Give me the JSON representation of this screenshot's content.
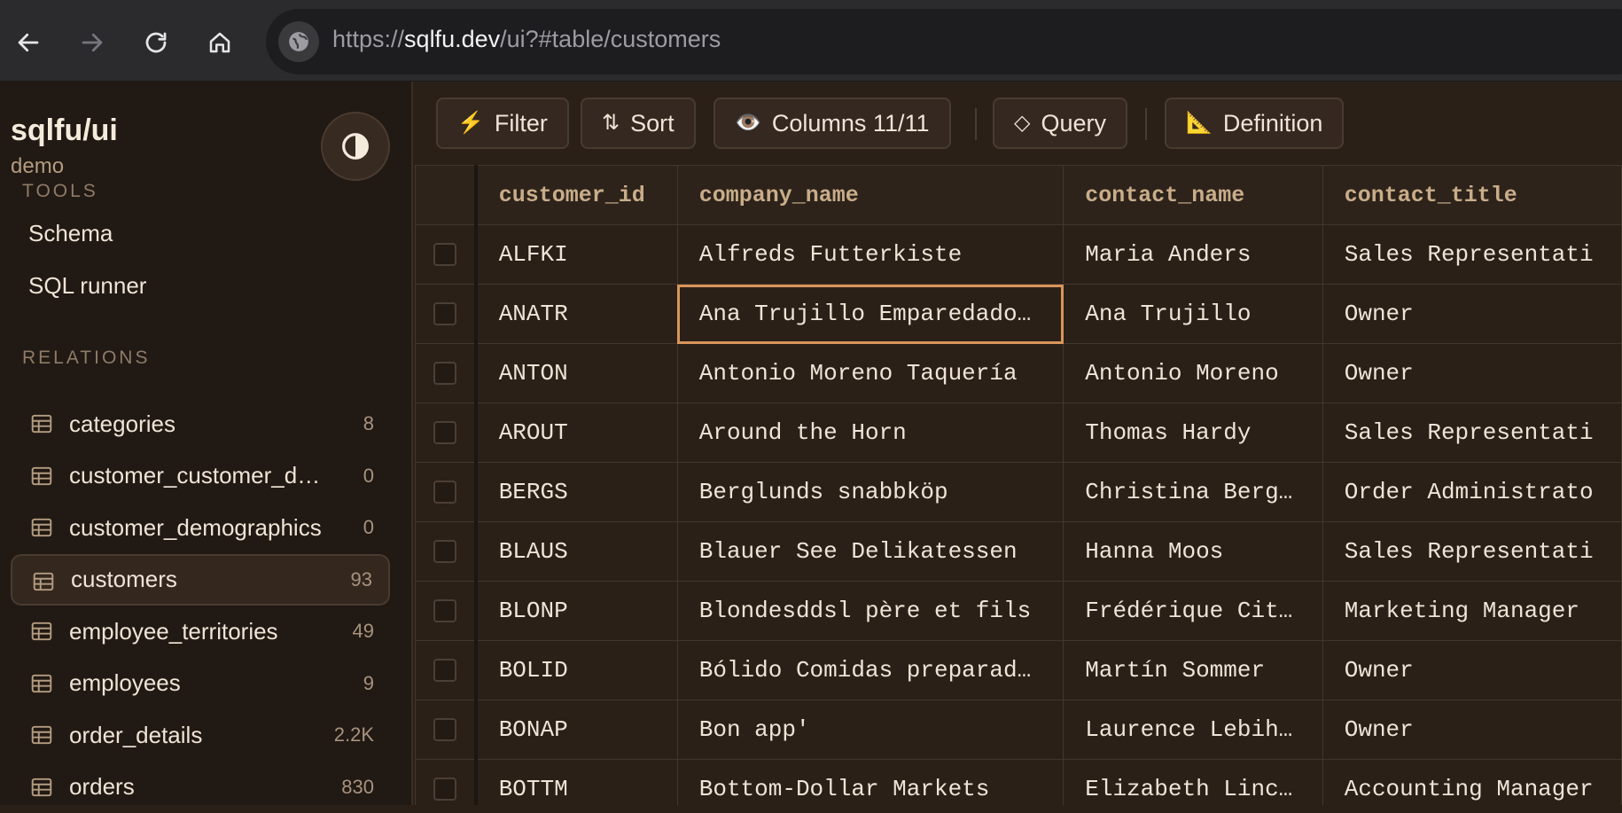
{
  "browser": {
    "url_scheme": "https://",
    "url_host": "sqlfu.dev",
    "url_path": "/ui?#table/customers",
    "icons": [
      "back-arrow-icon",
      "forward-arrow-icon",
      "reload-icon",
      "home-icon",
      "site-info-icon"
    ]
  },
  "sidebar": {
    "brand": "sqlfu/ui",
    "subtitle": "demo",
    "theme_toggle_icon": "contrast-icon",
    "tools_heading": "TOOLS",
    "tools": [
      {
        "label": "Schema"
      },
      {
        "label": "SQL runner"
      }
    ],
    "relations_heading": "RELATIONS",
    "relations": [
      {
        "name": "categories",
        "count": "8"
      },
      {
        "name": "customer_customer_d…",
        "count": "0"
      },
      {
        "name": "customer_demographics",
        "count": "0"
      },
      {
        "name": "customers",
        "count": "93"
      },
      {
        "name": "employee_territories",
        "count": "49"
      },
      {
        "name": "employees",
        "count": "9"
      },
      {
        "name": "order_details",
        "count": "2.2K"
      },
      {
        "name": "orders",
        "count": "830"
      }
    ]
  },
  "toolbar": {
    "filter": {
      "icon": "⚡",
      "label": "Filter"
    },
    "sort": {
      "icon": "⇅",
      "label": "Sort"
    },
    "columns": {
      "icon": "👁️",
      "label": "Columns 11/11"
    },
    "query": {
      "icon": "◇",
      "label": "Query"
    },
    "definition": {
      "icon": "📐",
      "label": "Definition"
    }
  },
  "table": {
    "columns": [
      "customer_id",
      "company_name",
      "contact_name",
      "contact_title"
    ],
    "rows": [
      [
        "ALFKI",
        "Alfreds Futterkiste",
        "Maria Anders",
        "Sales Representati"
      ],
      [
        "ANATR",
        "Ana Trujillo Emparedado…",
        "Ana Trujillo",
        "Owner"
      ],
      [
        "ANTON",
        "Antonio Moreno Taquería",
        "Antonio Moreno",
        "Owner"
      ],
      [
        "AROUT",
        "Around the Horn",
        "Thomas Hardy",
        "Sales Representati"
      ],
      [
        "BERGS",
        "Berglunds snabbköp",
        "Christina Berg…",
        "Order Administrato"
      ],
      [
        "BLAUS",
        "Blauer See Delikatessen",
        "Hanna Moos",
        "Sales Representati"
      ],
      [
        "BLONP",
        "Blondesddsl père et fils",
        "Frédérique Cit…",
        "Marketing Manager"
      ],
      [
        "BOLID",
        "Bólido Comidas preparad…",
        "Martín Sommer",
        "Owner"
      ],
      [
        "BONAP",
        "Bon app'",
        "Laurence Lebih…",
        "Owner"
      ],
      [
        "BOTTM",
        "Bottom-Dollar Markets",
        "Elizabeth Linc…",
        "Accounting Manager"
      ]
    ],
    "focused_cell": {
      "row": 1,
      "col": 1
    },
    "accent_color": "#d9955a"
  }
}
